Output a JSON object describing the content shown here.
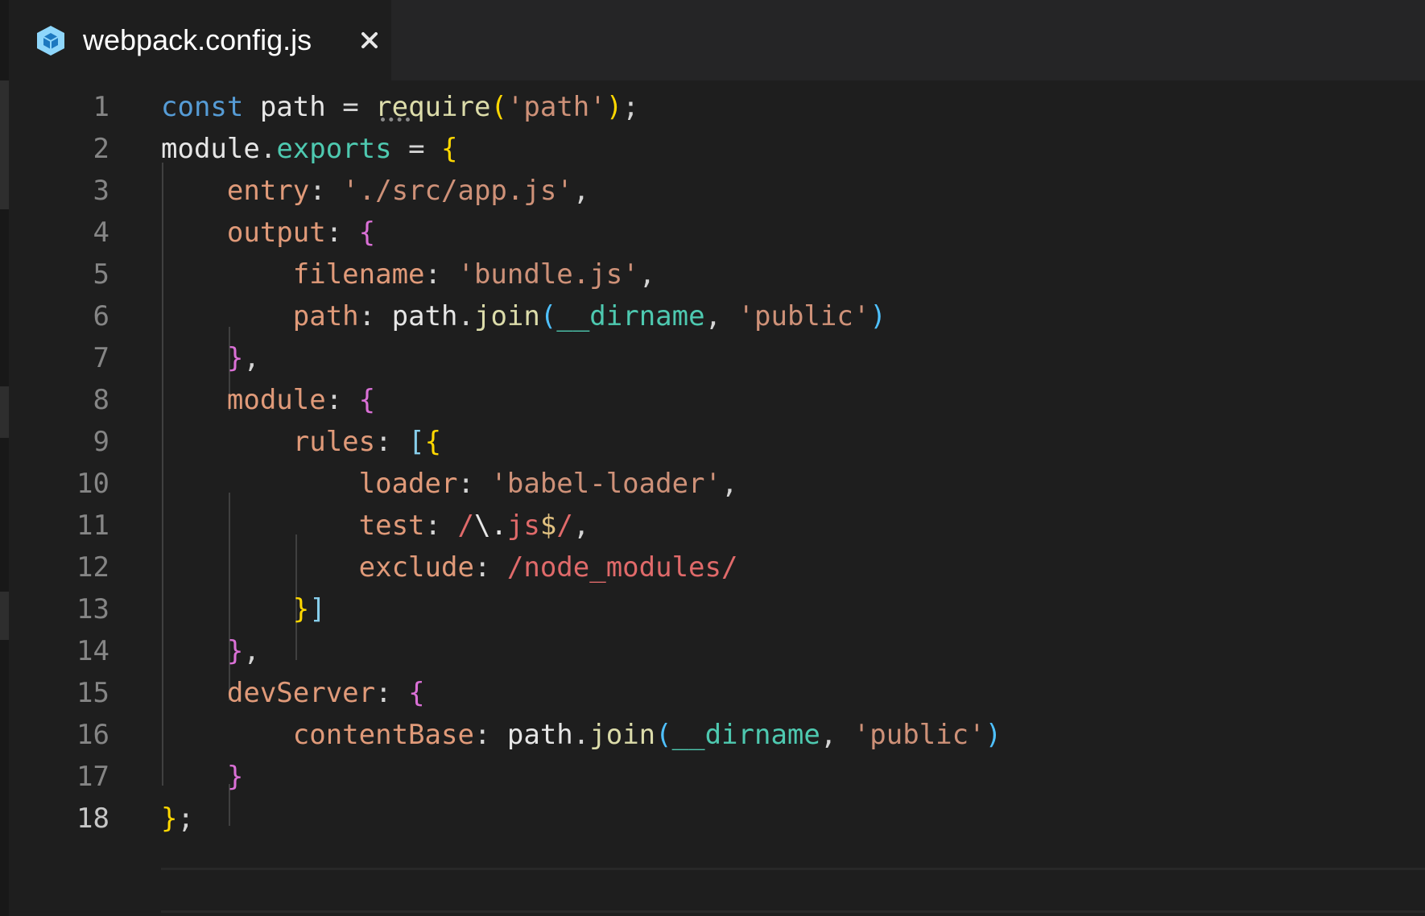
{
  "tab": {
    "title": "webpack.config.js",
    "icon": "webpack-cube-icon",
    "close_glyph": "✕"
  },
  "colors": {
    "background": "#1e1e1e",
    "keyword": "#569cd6",
    "string": "#ce9178",
    "function": "#dcdcaa",
    "property": "#e09a79",
    "builtin": "#4ec9b0",
    "regex": "#e06a6a",
    "brace_level1": "#ffd700",
    "brace_level2": "#da70d6",
    "brace_level3": "#4fc1ff"
  },
  "editor": {
    "active_line": "18",
    "line_numbers": [
      "1",
      "2",
      "3",
      "4",
      "5",
      "6",
      "7",
      "8",
      "9",
      "10",
      "11",
      "12",
      "13",
      "14",
      "15",
      "16",
      "17",
      "18"
    ],
    "lines": [
      [
        {
          "c": "k",
          "t": "const"
        },
        {
          "c": "v",
          "t": " path "
        },
        {
          "c": "p",
          "t": "= "
        },
        {
          "c": "f",
          "t": "require"
        },
        {
          "c": "by",
          "t": "("
        },
        {
          "c": "s",
          "t": "'path'"
        },
        {
          "c": "by",
          "t": ")"
        },
        {
          "c": "p",
          "t": ";"
        }
      ],
      [
        {
          "c": "v",
          "t": "module"
        },
        {
          "c": "p",
          "t": "."
        },
        {
          "c": "t",
          "t": "exports"
        },
        {
          "c": "p",
          "t": " = "
        },
        {
          "c": "by",
          "t": "{"
        }
      ],
      [
        {
          "c": "p",
          "t": "    "
        },
        {
          "c": "pr",
          "t": "entry"
        },
        {
          "c": "p",
          "t": ": "
        },
        {
          "c": "s",
          "t": "'./src/app.js'"
        },
        {
          "c": "p",
          "t": ","
        }
      ],
      [
        {
          "c": "p",
          "t": "    "
        },
        {
          "c": "pr",
          "t": "output"
        },
        {
          "c": "p",
          "t": ": "
        },
        {
          "c": "bp",
          "t": "{"
        }
      ],
      [
        {
          "c": "p",
          "t": "        "
        },
        {
          "c": "pr",
          "t": "filename"
        },
        {
          "c": "p",
          "t": ": "
        },
        {
          "c": "s",
          "t": "'bundle.js'"
        },
        {
          "c": "p",
          "t": ","
        }
      ],
      [
        {
          "c": "p",
          "t": "        "
        },
        {
          "c": "pr",
          "t": "path"
        },
        {
          "c": "p",
          "t": ": "
        },
        {
          "c": "v",
          "t": "path"
        },
        {
          "c": "p",
          "t": "."
        },
        {
          "c": "f",
          "t": "join"
        },
        {
          "c": "bb",
          "t": "("
        },
        {
          "c": "t",
          "t": "__dirname"
        },
        {
          "c": "p",
          "t": ", "
        },
        {
          "c": "s",
          "t": "'public'"
        },
        {
          "c": "bb",
          "t": ")"
        }
      ],
      [
        {
          "c": "p",
          "t": "    "
        },
        {
          "c": "bp",
          "t": "}"
        },
        {
          "c": "p",
          "t": ","
        }
      ],
      [
        {
          "c": "p",
          "t": "    "
        },
        {
          "c": "pr",
          "t": "module"
        },
        {
          "c": "p",
          "t": ": "
        },
        {
          "c": "bp",
          "t": "{"
        }
      ],
      [
        {
          "c": "p",
          "t": "        "
        },
        {
          "c": "pr",
          "t": "rules"
        },
        {
          "c": "p",
          "t": ": "
        },
        {
          "c": "bl",
          "t": "["
        },
        {
          "c": "by",
          "t": "{"
        }
      ],
      [
        {
          "c": "p",
          "t": "            "
        },
        {
          "c": "pr",
          "t": "loader"
        },
        {
          "c": "p",
          "t": ": "
        },
        {
          "c": "s",
          "t": "'babel-loader'"
        },
        {
          "c": "p",
          "t": ","
        }
      ],
      [
        {
          "c": "p",
          "t": "            "
        },
        {
          "c": "pr",
          "t": "test"
        },
        {
          "c": "p",
          "t": ": "
        },
        {
          "c": "re",
          "t": "/"
        },
        {
          "c": "v",
          "t": "\\."
        },
        {
          "c": "re",
          "t": "js"
        },
        {
          "c": "rc",
          "t": "$"
        },
        {
          "c": "re",
          "t": "/"
        },
        {
          "c": "p",
          "t": ","
        }
      ],
      [
        {
          "c": "p",
          "t": "            "
        },
        {
          "c": "pr",
          "t": "exclude"
        },
        {
          "c": "p",
          "t": ": "
        },
        {
          "c": "re",
          "t": "/node_modules/"
        }
      ],
      [
        {
          "c": "p",
          "t": "        "
        },
        {
          "c": "by",
          "t": "}"
        },
        {
          "c": "bl",
          "t": "]"
        }
      ],
      [
        {
          "c": "p",
          "t": "    "
        },
        {
          "c": "bp",
          "t": "}"
        },
        {
          "c": "p",
          "t": ","
        }
      ],
      [
        {
          "c": "p",
          "t": "    "
        },
        {
          "c": "pr",
          "t": "devServer"
        },
        {
          "c": "p",
          "t": ": "
        },
        {
          "c": "bp",
          "t": "{"
        }
      ],
      [
        {
          "c": "p",
          "t": "        "
        },
        {
          "c": "pr",
          "t": "contentBase"
        },
        {
          "c": "p",
          "t": ": "
        },
        {
          "c": "v",
          "t": "path"
        },
        {
          "c": "p",
          "t": "."
        },
        {
          "c": "f",
          "t": "join"
        },
        {
          "c": "bb",
          "t": "("
        },
        {
          "c": "t",
          "t": "__dirname"
        },
        {
          "c": "p",
          "t": ", "
        },
        {
          "c": "s",
          "t": "'public'"
        },
        {
          "c": "bb",
          "t": ")"
        }
      ],
      [
        {
          "c": "p",
          "t": "    "
        },
        {
          "c": "bp",
          "t": "}"
        }
      ],
      [
        {
          "c": "by",
          "t": "}"
        },
        {
          "c": "p",
          "t": ";"
        }
      ]
    ]
  }
}
